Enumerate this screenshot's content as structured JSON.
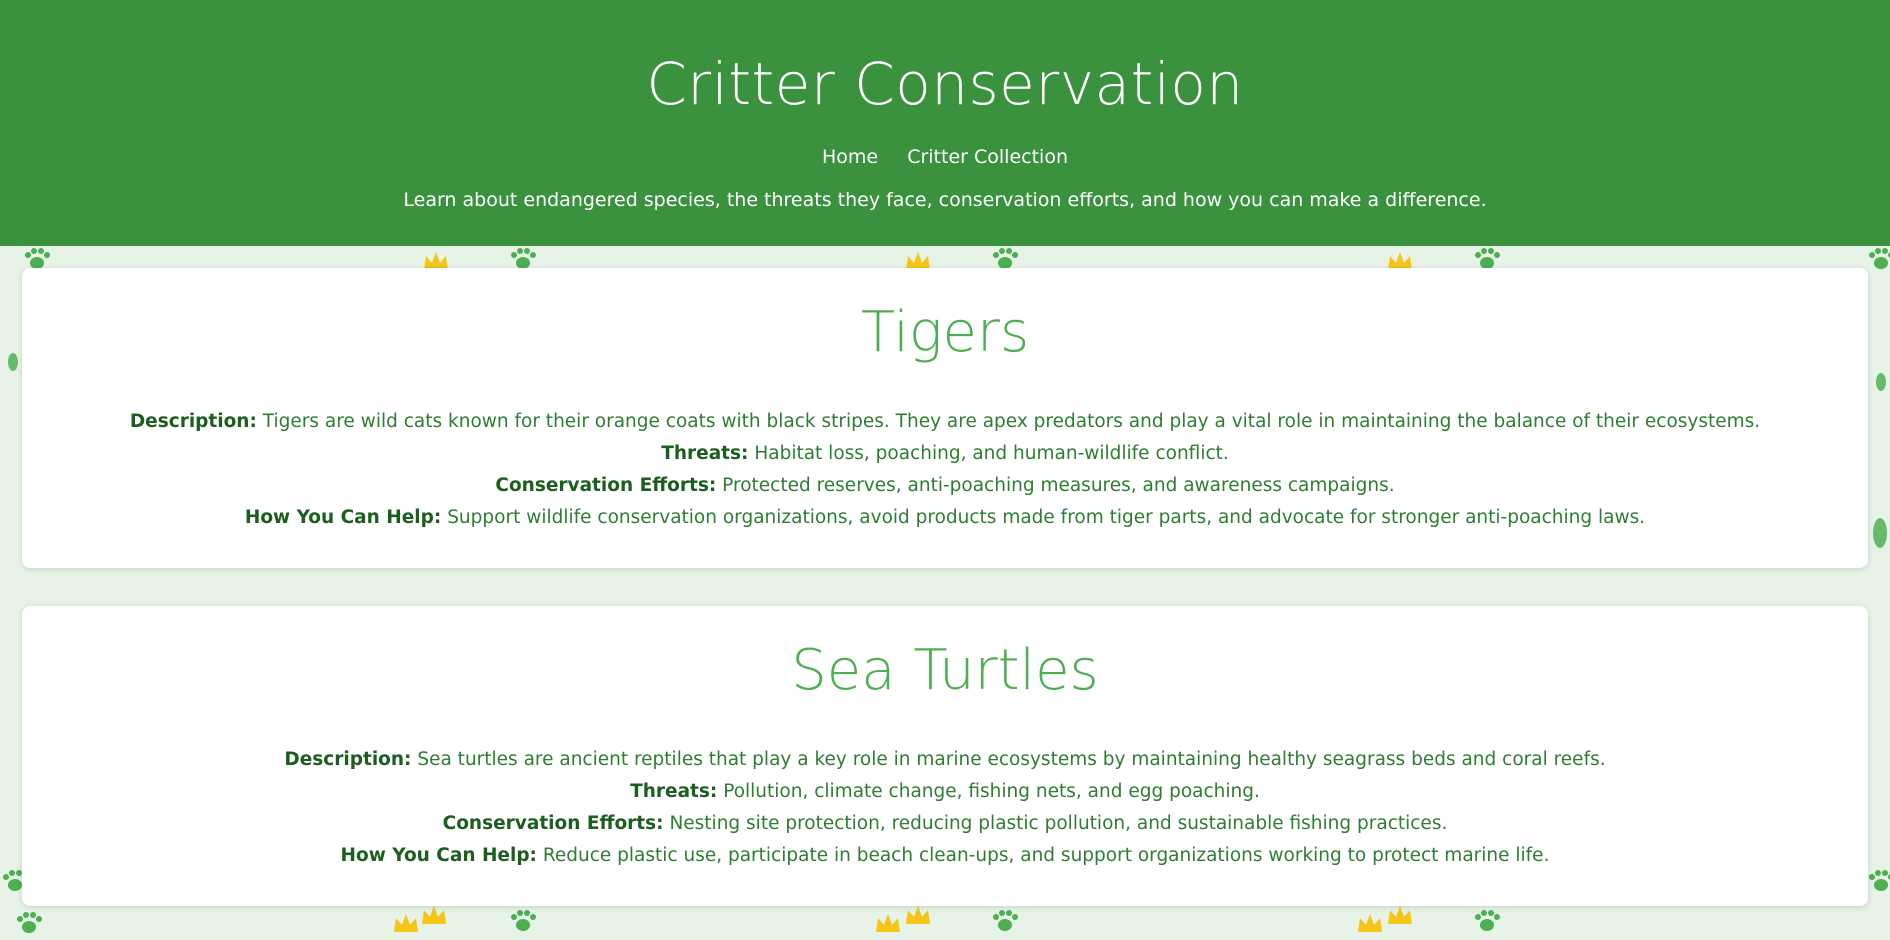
{
  "header": {
    "title": "Critter Conservation",
    "nav": [
      {
        "label": "Home"
      },
      {
        "label": "Critter Collection"
      }
    ],
    "tagline": "Learn about endangered species, the threats they face, conservation efforts, and how you can make a difference."
  },
  "labels": {
    "description": "Description:",
    "threats": "Threats:",
    "efforts": "Conservation Efforts:",
    "help": "How You Can Help:"
  },
  "species": [
    {
      "name": "Tigers",
      "description": "Tigers are wild cats known for their orange coats with black stripes. They are apex predators and play a vital role in maintaining the balance of their ecosystems.",
      "threats": "Habitat loss, poaching, and human-wildlife conflict.",
      "efforts": "Protected reserves, anti-poaching measures, and awareness campaigns.",
      "help": "Support wildlife conservation organizations, avoid products made from tiger parts, and advocate for stronger anti-poaching laws."
    },
    {
      "name": "Sea Turtles",
      "description": "Sea turtles are ancient reptiles that play a key role in marine ecosystems by maintaining healthy seagrass beds and coral reefs.",
      "threats": "Pollution, climate change, fishing nets, and egg poaching.",
      "efforts": "Nesting site protection, reducing plastic pollution, and sustainable fishing practices.",
      "help": "Reduce plastic use, participate in beach clean-ups, and support organizations working to protect marine life."
    }
  ],
  "colors": {
    "header_bg": "#3a913e",
    "page_bg": "#e6f3e6",
    "heading": "#4caf50",
    "text": "#2e7d32",
    "paw": "#4caf50",
    "crown": "#f5c518"
  }
}
